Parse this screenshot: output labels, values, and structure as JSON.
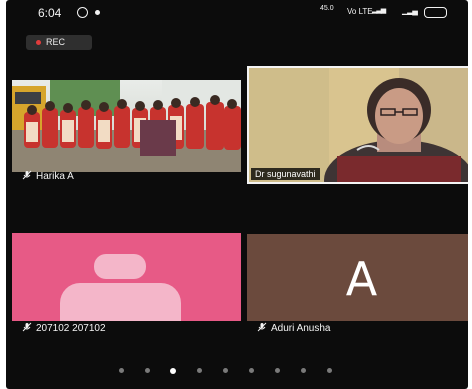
{
  "status_bar": {
    "time": "6:04",
    "net_speed": "45.0",
    "net_type": "Vo LTE"
  },
  "recording": {
    "label": "REC"
  },
  "participants": [
    {
      "name": "Harika A",
      "muted": true,
      "video": "group photo of students in red uniforms"
    },
    {
      "name": "Dr sugunavathi",
      "muted": false,
      "video": "woman on video call"
    },
    {
      "name": "207102 207102",
      "muted": true,
      "avatar_color": "#e75a86"
    },
    {
      "name": "Aduri Anusha",
      "muted": true,
      "avatar_letter": "A",
      "avatar_color": "#6b4a3d"
    }
  ],
  "pagination": {
    "pages": 9,
    "active": 3
  },
  "colors": {
    "background": "#0c0c0c",
    "rec_dot": "#e23c3c",
    "pink_tile": "#e75a86",
    "brown_tile": "#6b4a3d"
  }
}
